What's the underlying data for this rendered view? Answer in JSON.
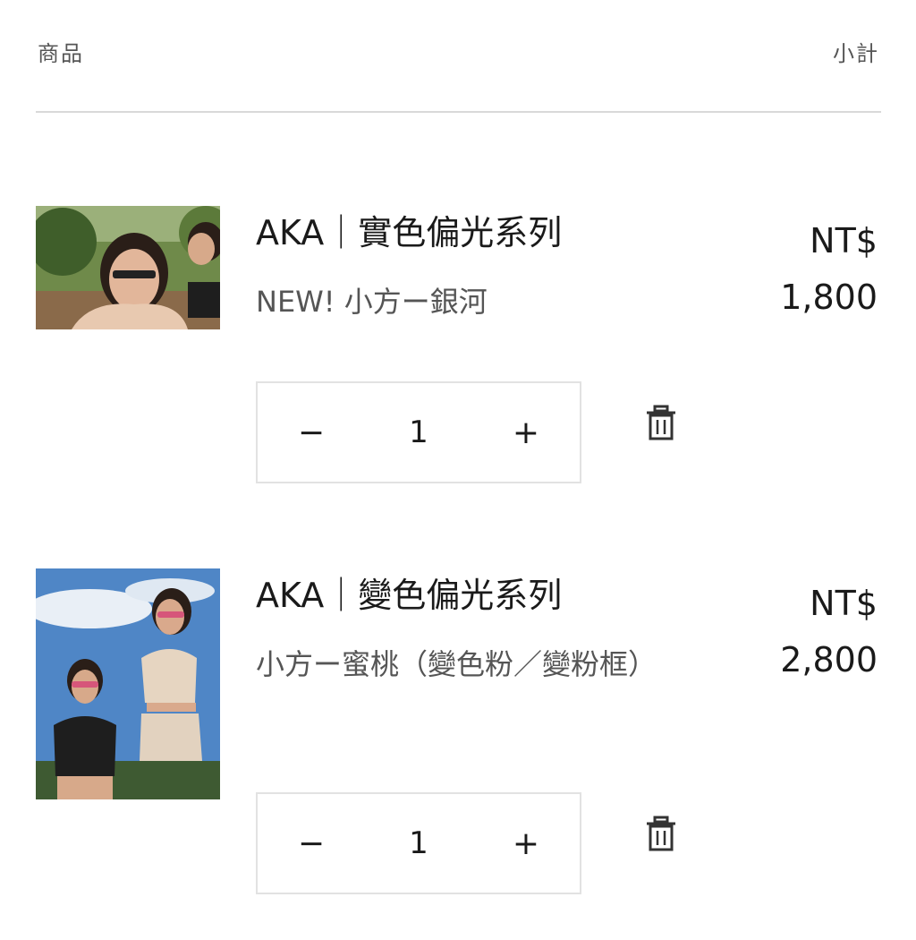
{
  "header": {
    "product_label": "商品",
    "subtotal_label": "小計"
  },
  "items": [
    {
      "title": "AKA｜實色偏光系列",
      "variant": "NEW! 小方ー銀河",
      "currency": "NT$",
      "amount": "1,800",
      "quantity": "1",
      "minus": "−",
      "plus": "+"
    },
    {
      "title": "AKA｜變色偏光系列",
      "variant": "小方ー蜜桃（變色粉／變粉框）",
      "currency": "NT$",
      "amount": "2,800",
      "quantity": "1",
      "minus": "−",
      "plus": "+"
    }
  ],
  "icons": {
    "delete": "trash-icon"
  }
}
